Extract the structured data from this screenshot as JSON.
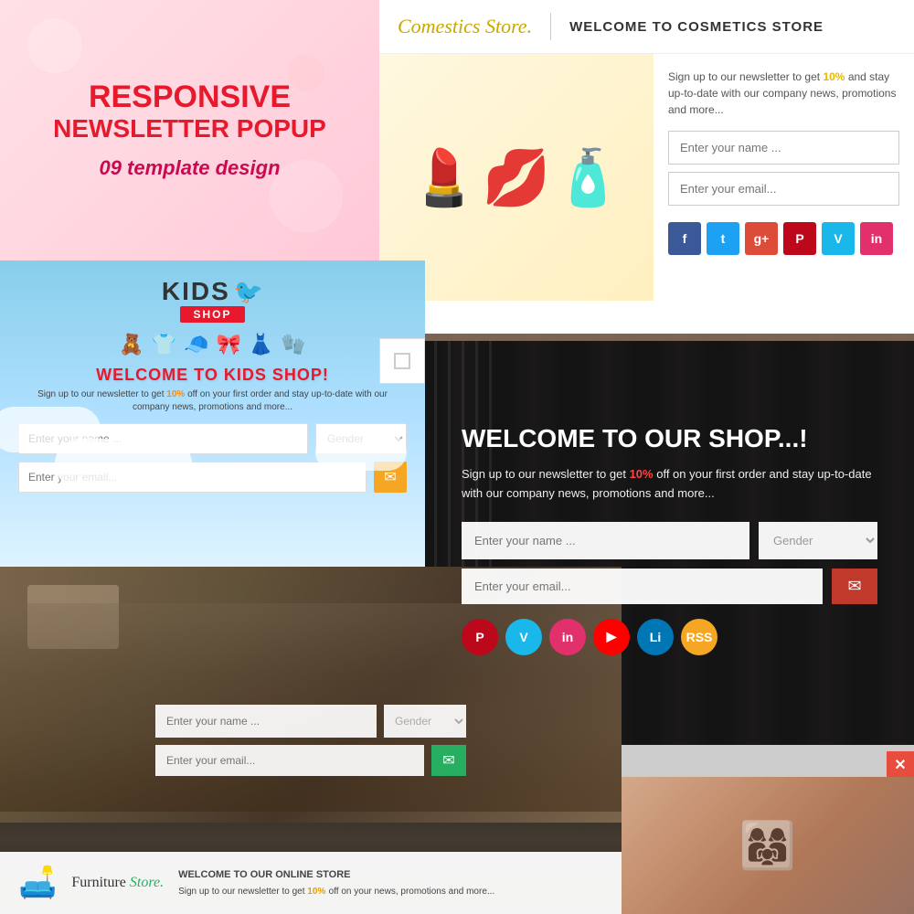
{
  "topLeft": {
    "title_line1": "RESPONSIVE",
    "title_line2": "NEWSLETTER POPUP",
    "subtitle": "09 template design"
  },
  "cosmeticsStore": {
    "logo_text": "Comestics",
    "logo_script": "Store.",
    "welcome": "WELCOME TO COSMETICS STORE",
    "signup_text": "Sign up to our newsletter to get ",
    "discount": "10%",
    "signup_text2": " and stay up-to-date with our company news, promotions and more...",
    "name_placeholder": "Enter your name ...",
    "email_placeholder": "Enter your email...",
    "social_icons": [
      "f",
      "t",
      "g+",
      "P",
      "V",
      "in"
    ]
  },
  "kidsShop": {
    "brand": "KIDS",
    "badge": "SHOP",
    "welcome": "WELCOME TO KIDS SHOP!",
    "signup_prefix": "Sign up to our newsletter to get ",
    "discount": "10%",
    "signup_suffix": " off on your first order and stay up-to-date with our company news, promotions and more...",
    "name_placeholder": "Enter your name ...",
    "gender_placeholder": "Gender",
    "email_placeholder": "Enter your email...",
    "submit_icon": "✉"
  },
  "fashionShop": {
    "title": "WELCOME TO OUR SHOP...!",
    "signup_prefix": "Sign up to our newsletter to get ",
    "discount": "10%",
    "signup_suffix": " off on your first order and stay up-to-date with our company news, promotions and more...",
    "name_placeholder": "Enter your name ...",
    "gender_placeholder": "Gender",
    "email_placeholder": "Enter your email...",
    "submit_icon": "✉",
    "social_icons": [
      "P",
      "V",
      "in",
      "YT",
      "Li",
      "RSS"
    ]
  },
  "furnitureStore": {
    "name_placeholder": "Enter your name ...",
    "gender_placeholder": "Gender",
    "email_placeholder": "Enter your email...",
    "submit_icon": "✉",
    "brand_name": "Furniture",
    "brand_script": "Store.",
    "welcome": "WELCOME TO OUR ONLINE STORE",
    "signup_prefix": "Sign up to our newsletter to get ",
    "discount": "10%",
    "signup_suffix": " off on your news, promotions and more..."
  },
  "closeBtn": "✕"
}
